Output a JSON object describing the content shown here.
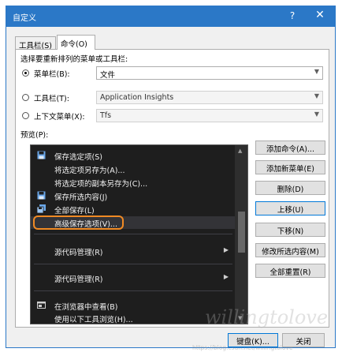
{
  "window": {
    "title": "自定义",
    "help_glyph": "?",
    "close_glyph": "✕"
  },
  "tabs": [
    {
      "label": "工具栏(S)",
      "active": false
    },
    {
      "label": "命令(O)",
      "active": true
    }
  ],
  "section_label": "选择要重新排列的菜单或工具栏:",
  "options": [
    {
      "label": "菜单栏(B):",
      "selected": true,
      "value": "文件",
      "enabled": true
    },
    {
      "label": "工具栏(T):",
      "selected": false,
      "value": "Application Insights",
      "enabled": false
    },
    {
      "label": "上下文菜单(X):",
      "selected": false,
      "value": "Tfs",
      "enabled": false
    }
  ],
  "preview_label": "预览(P):",
  "preview_items": [
    {
      "label": "保存选定项(S)",
      "icon": "save-icon",
      "submenu": false
    },
    {
      "label": "将选定项另存为(A)...",
      "icon": "",
      "submenu": false
    },
    {
      "label": "将选定项的副本另存为(C)...",
      "icon": "",
      "submenu": false
    },
    {
      "label": "保存所选内容(J)",
      "icon": "save-icon",
      "submenu": false
    },
    {
      "label": "全部保存(L)",
      "icon": "save-all-icon",
      "submenu": false
    },
    {
      "label": "高级保存选项(V)...",
      "icon": "",
      "submenu": false,
      "selected": true,
      "highlighted": true
    },
    {
      "label": "源代码管理(R)",
      "icon": "",
      "submenu": true
    },
    {
      "label": "源代码管理(R)",
      "icon": "",
      "submenu": true
    },
    {
      "label": "在浏览器中查看(B)",
      "icon": "browser-icon",
      "submenu": false
    },
    {
      "label": "使用以下工具浏览(H)...",
      "icon": "",
      "submenu": false
    }
  ],
  "side_buttons": [
    {
      "label": "添加命令(A)...",
      "enabled": true
    },
    {
      "label": "添加新菜单(E)",
      "enabled": true
    },
    {
      "label": "删除(D)",
      "enabled": true
    },
    {
      "label": "上移(U)",
      "enabled": true
    },
    {
      "label": "下移(N)",
      "enabled": true
    },
    {
      "label": "修改所选内容(M)",
      "enabled": true
    },
    {
      "label": "全部重置(R)",
      "enabled": true
    }
  ],
  "footer": {
    "keyboard_label": "键盘(K)...",
    "close_label": "关闭"
  },
  "watermark": {
    "text": "willingtolove",
    "url": "https://blog.csdn.net/willingtolove"
  },
  "colors": {
    "titlebar": "#2b78c7",
    "preview_bg": "#1e1e1e",
    "highlight_ring": "#f08a24",
    "focus": "#0078d7"
  }
}
